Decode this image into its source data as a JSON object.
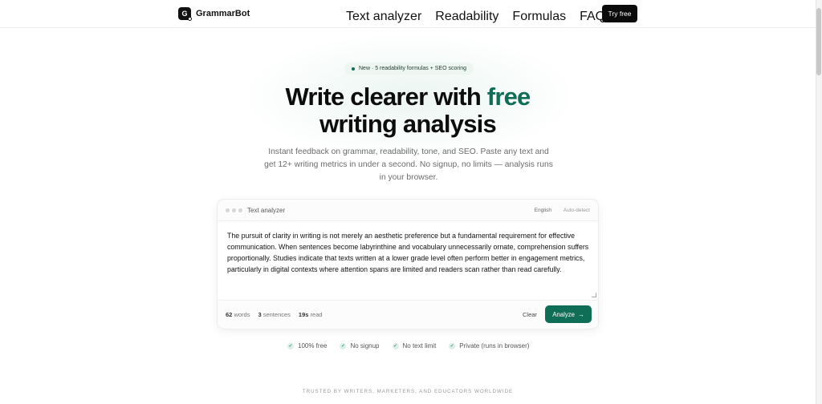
{
  "header": {
    "brand": {
      "logo_letter": "G",
      "name": "GrammarBot"
    },
    "nav": [
      "Text analyzer",
      "Readability",
      "Formulas",
      "FAQ"
    ],
    "cta": "Try free"
  },
  "hero": {
    "pill": "New · 5 readability formulas + SEO scoring",
    "headline_part1": "Write clearer with ",
    "headline_accent": "free",
    "headline_part2": "writing analysis",
    "subtitle": "Instant feedback on grammar, readability, tone, and SEO. Paste any text and get 12+ writing metrics in under a second. No signup, no limits — analysis runs in your browser."
  },
  "analyzer": {
    "title": "Text analyzer",
    "language": "English",
    "auto_detect": "Auto-detect",
    "text": "The pursuit of clarity in writing is not merely an aesthetic preference but a fundamental requirement for effective communication. When sentences become labyrinthine and vocabulary unnecessarily ornate, comprehension suffers proportionally. Studies indicate that texts written at a lower grade level often perform better in engagement metrics, particularly in digital contexts where attention spans are limited and readers scan rather than read carefully.",
    "stats": {
      "words_value": "62",
      "words_label": "words",
      "sentences_value": "3",
      "sentences_label": "sentences",
      "read_value": "19s",
      "read_label": "read"
    },
    "clear_label": "Clear",
    "analyze_label": "Analyze",
    "analyze_arrow": "→"
  },
  "features": [
    "100% free",
    "No signup",
    "No text limit",
    "Private (runs in browser)"
  ],
  "trusted": "TRUSTED BY WRITERS, MARKETERS, AND EDUCATORS WORLDWIDE",
  "colors": {
    "accent": "#0f6e55",
    "dark": "#0b0b0b"
  }
}
